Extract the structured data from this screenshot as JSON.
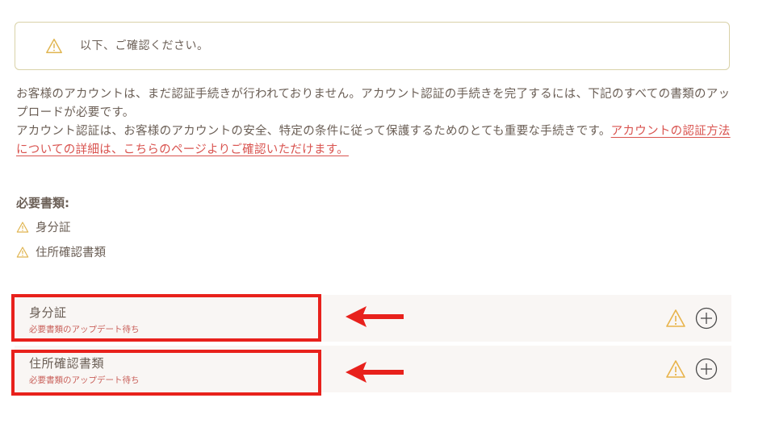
{
  "notice": {
    "icon": "warning-icon",
    "text": "以下、ご確認ください。"
  },
  "intro": {
    "paragraph1": "お客様のアカウントは、まだ認証手続きが行われておりません。アカウント認証の手続きを完了するには、下記のすべての書類のアップロードが必要です。",
    "paragraph2_text": "アカウント認証は、お客様のアカウントの安全、特定の条件に従って保護するためのとても重要な手続きです。",
    "paragraph2_link": "アカウントの認証方法についての詳細は、こちらのページよりご確認いただけます。"
  },
  "required": {
    "title": "必要書類:",
    "items": [
      {
        "label": "身分証",
        "icon": "warning-icon"
      },
      {
        "label": "住所確認書類",
        "icon": "warning-icon"
      }
    ]
  },
  "documents": [
    {
      "name": "身分証",
      "status": "必要書類のアップデート待ち",
      "status_icon": "warning-icon",
      "action_icon": "plus-circle-icon"
    },
    {
      "name": "住所確認書類",
      "status": "必要書類のアップデート待ち",
      "status_icon": "warning-icon",
      "action_icon": "plus-circle-icon"
    }
  ],
  "colors": {
    "text": "#6b5f56",
    "link": "#d9534f",
    "status": "#c9605a",
    "warning": "#e8b34a",
    "highlight": "#e8211c",
    "notice_border": "#d9d2a8",
    "row_bg": "#f9f6f4"
  }
}
